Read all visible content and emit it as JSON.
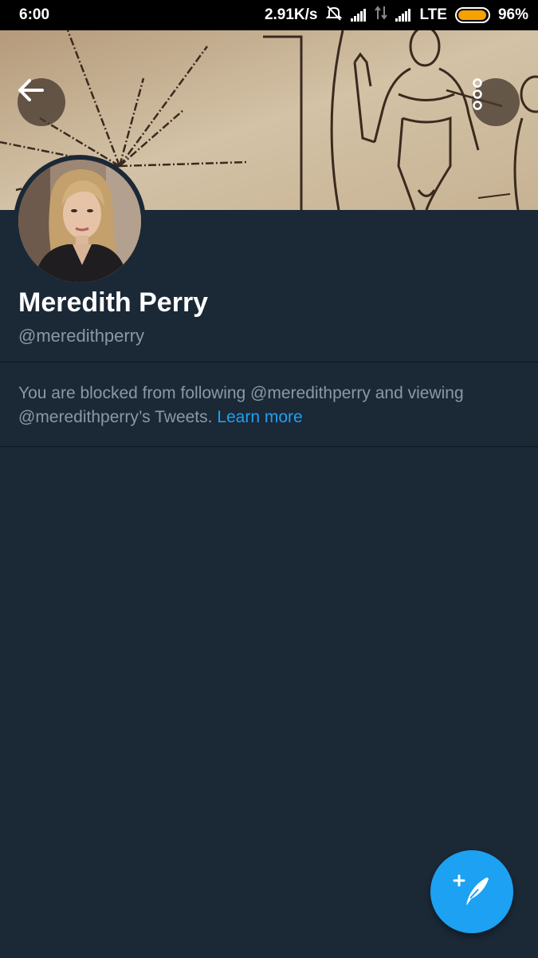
{
  "status_bar": {
    "time": "6:00",
    "speed": "2.91K/s",
    "network": "LTE",
    "battery": "96%",
    "battery_level": 0.96,
    "battery_color": "#f5a201"
  },
  "header": {
    "back_icon": "arrow-left-icon",
    "more_icon": "vertical-dots-icon"
  },
  "profile": {
    "name": "Meredith Perry",
    "handle": "@meredithperry"
  },
  "blocked": {
    "message": "You are blocked from following @meredithperry and viewing @meredithperry’s Tweets.",
    "link": "Learn more"
  },
  "fab": {
    "icon": "compose-tweet-icon"
  },
  "colors": {
    "background": "#1b2836",
    "accent": "#1da1f2",
    "secondary_text": "#8899a6"
  }
}
